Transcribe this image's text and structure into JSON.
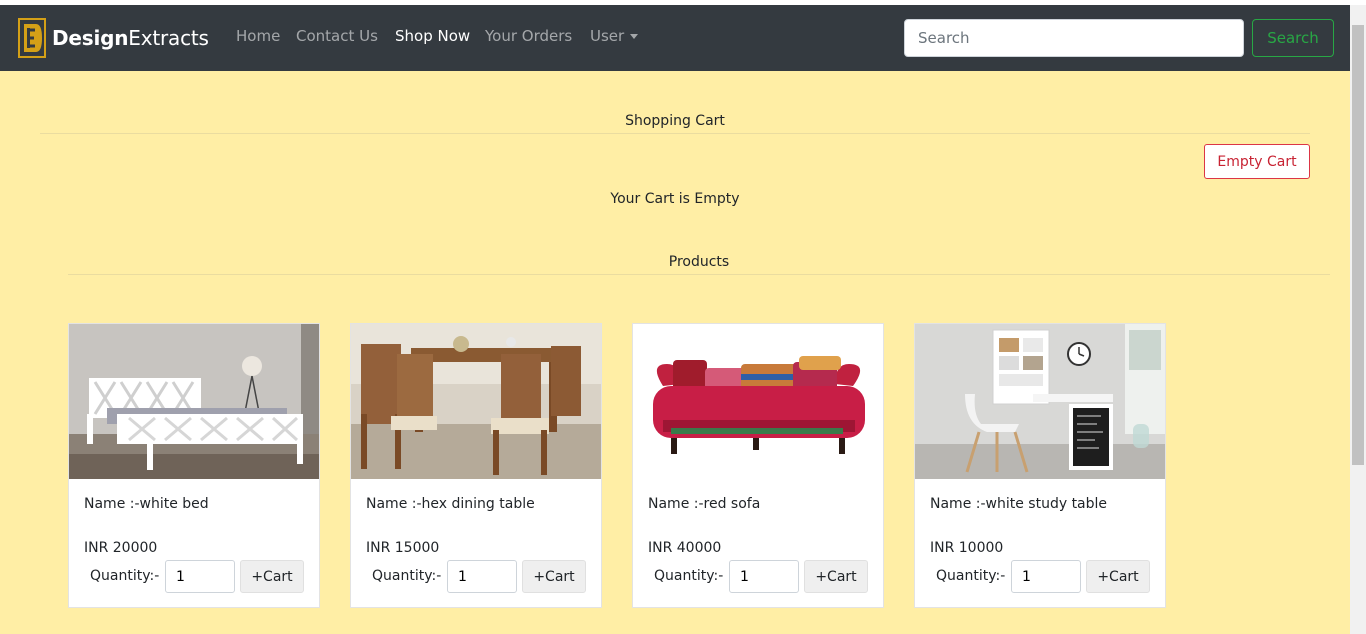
{
  "brand": {
    "bold": "Design",
    "rest": "Extracts",
    "accent_color": "#d4a017"
  },
  "nav": {
    "items": [
      {
        "label": "Home"
      },
      {
        "label": "Contact Us"
      },
      {
        "label": "Shop Now"
      },
      {
        "label": "Your Orders"
      },
      {
        "label": "User"
      }
    ],
    "active": "Shop Now"
  },
  "search": {
    "placeholder": "Search",
    "button_label": "Search",
    "button_color": "#28a745"
  },
  "cart": {
    "title": "Shopping Cart",
    "empty_button": "Empty Cart",
    "empty_message": "Your Cart is Empty"
  },
  "products": {
    "title": "Products",
    "items": [
      {
        "name": "Name :-white bed",
        "price": "INR 20000",
        "qty_label": "Quantity:-",
        "qty": "1",
        "button": "+Cart",
        "image": "white-bed-photo"
      },
      {
        "name": "Name :-hex dining table",
        "price": "INR 15000",
        "qty_label": "Quantity:-",
        "qty": "1",
        "button": "+Cart",
        "image": "dining-table-photo"
      },
      {
        "name": "Name :-red sofa",
        "price": "INR 40000",
        "qty_label": "Quantity:-",
        "qty": "1",
        "button": "+Cart",
        "image": "red-sofa-photo"
      },
      {
        "name": "Name :-white study table",
        "price": "INR 10000",
        "qty_label": "Quantity:-",
        "qty": "1",
        "button": "+Cart",
        "image": "study-table-photo"
      }
    ]
  },
  "colors": {
    "page_bg": "#ffeea5",
    "navbar_bg": "#343a40",
    "danger": "#dc3545"
  }
}
